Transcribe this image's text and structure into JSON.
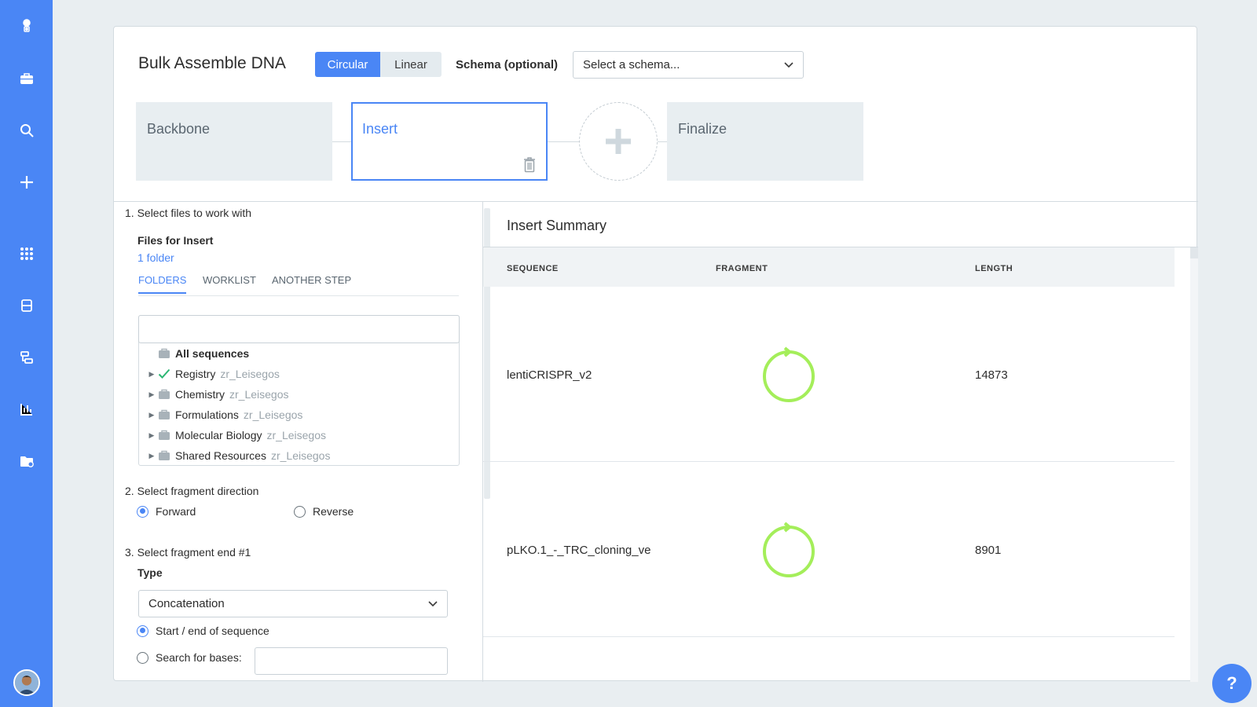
{
  "sidebar": {
    "items": [
      "logo-icon",
      "briefcase-icon",
      "search-icon",
      "plus-icon",
      "apps-grid-icon",
      "inbox-icon",
      "workflow-icon",
      "bar-chart-icon",
      "folder-settings-icon"
    ]
  },
  "header": {
    "title": "Bulk Assemble DNA",
    "toggle": {
      "circular": "Circular",
      "linear": "Linear"
    },
    "schema_label": "Schema (optional)",
    "schema_placeholder": "Select a schema..."
  },
  "steps": {
    "backbone": "Backbone",
    "insert": "Insert",
    "finalize": "Finalize"
  },
  "left": {
    "section1": "1. Select files to work with",
    "files_title": "Files for Insert",
    "folder_count": "1 folder",
    "tabs": [
      "FOLDERS",
      "WORKLIST",
      "ANOTHER STEP"
    ],
    "tree": {
      "root": "All sequences",
      "items": [
        {
          "name": "Registry",
          "owner": "zr_Leisegos",
          "checked": true
        },
        {
          "name": "Chemistry",
          "owner": "zr_Leisegos",
          "checked": false
        },
        {
          "name": "Formulations",
          "owner": "zr_Leisegos",
          "checked": false
        },
        {
          "name": "Molecular Biology",
          "owner": "zr_Leisegos",
          "checked": false
        },
        {
          "name": "Shared Resources",
          "owner": "zr_Leisegos",
          "checked": false
        }
      ]
    },
    "section2": "2. Select fragment direction",
    "direction": {
      "forward": "Forward",
      "reverse": "Reverse",
      "selected": "Forward"
    },
    "section3": "3. Select fragment end #1",
    "type_label": "Type",
    "type_value": "Concatenation",
    "end_options": {
      "start_end": "Start / end of sequence",
      "search": "Search for bases:"
    }
  },
  "right": {
    "title": "Insert Summary",
    "columns": [
      "SEQUENCE",
      "FRAGMENT",
      "LENGTH"
    ],
    "rows": [
      {
        "sequence": "lentiCRISPR_v2",
        "length": "14873"
      },
      {
        "sequence": "pLKO.1_-_TRC_cloning_ve",
        "length": "8901"
      }
    ]
  },
  "help_label": "?",
  "colors": {
    "accent": "#4a86f5",
    "fragment": "#a4ee5a",
    "check": "#2bb673"
  }
}
